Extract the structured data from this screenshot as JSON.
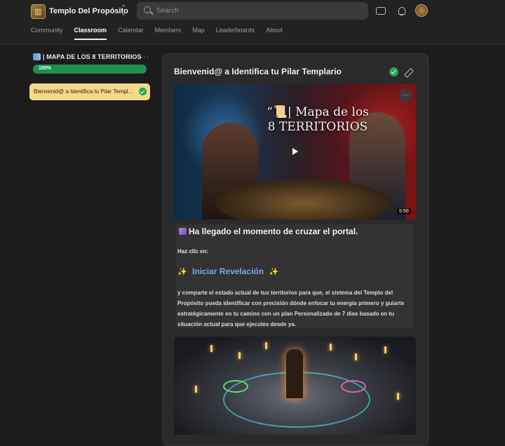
{
  "header": {
    "brand": "Templo Del Propósito",
    "search_placeholder": "Search"
  },
  "nav": {
    "tabs": [
      {
        "label": "Community"
      },
      {
        "label": "Classroom",
        "active": true
      },
      {
        "label": "Calendar"
      },
      {
        "label": "Members"
      },
      {
        "label": "Map"
      },
      {
        "label": "Leaderboards"
      },
      {
        "label": "About"
      }
    ]
  },
  "sidebar": {
    "course_title": "| MAPA DE LOS 8 TERRITORIOS",
    "progress_label": "100%",
    "progress_value": 1.0,
    "lesson_label": "Bienvenid@ a Identifica tu Pilar Templario"
  },
  "lesson": {
    "title": "Bienvenid@ a Identifica tu Pilar Templario",
    "video": {
      "title_line1": "“📜| Mapa de los",
      "title_line2": "8 TERRITORIOS",
      "duration": "5:50",
      "menu": "···"
    },
    "content": {
      "heading": "Ha llegado el momento de cruzar el portal.",
      "intro": "Haz clic en:",
      "cta_label": "Iniciar Revelación",
      "body": "y comparte el estado actual de tus territorios para que, el sistema del Templo del Propósito pueda identificar con precisión dónde enfocar tu energía primero y guiarte estratégicamente en tu camino con un plan Personalizado de 7 días basado en tu situación actual para que ejecutes desde ya."
    }
  },
  "colors": {
    "accent_green": "#22a35a",
    "selected_lesson_bg": "#f5d98a",
    "link_blue": "#7aa7e8"
  },
  "icons": [
    "search-icon",
    "chat-icon",
    "bell-icon",
    "check-icon",
    "pencil-icon",
    "play-icon",
    "map-icon",
    "portal-icon",
    "sparkle-icon"
  ]
}
